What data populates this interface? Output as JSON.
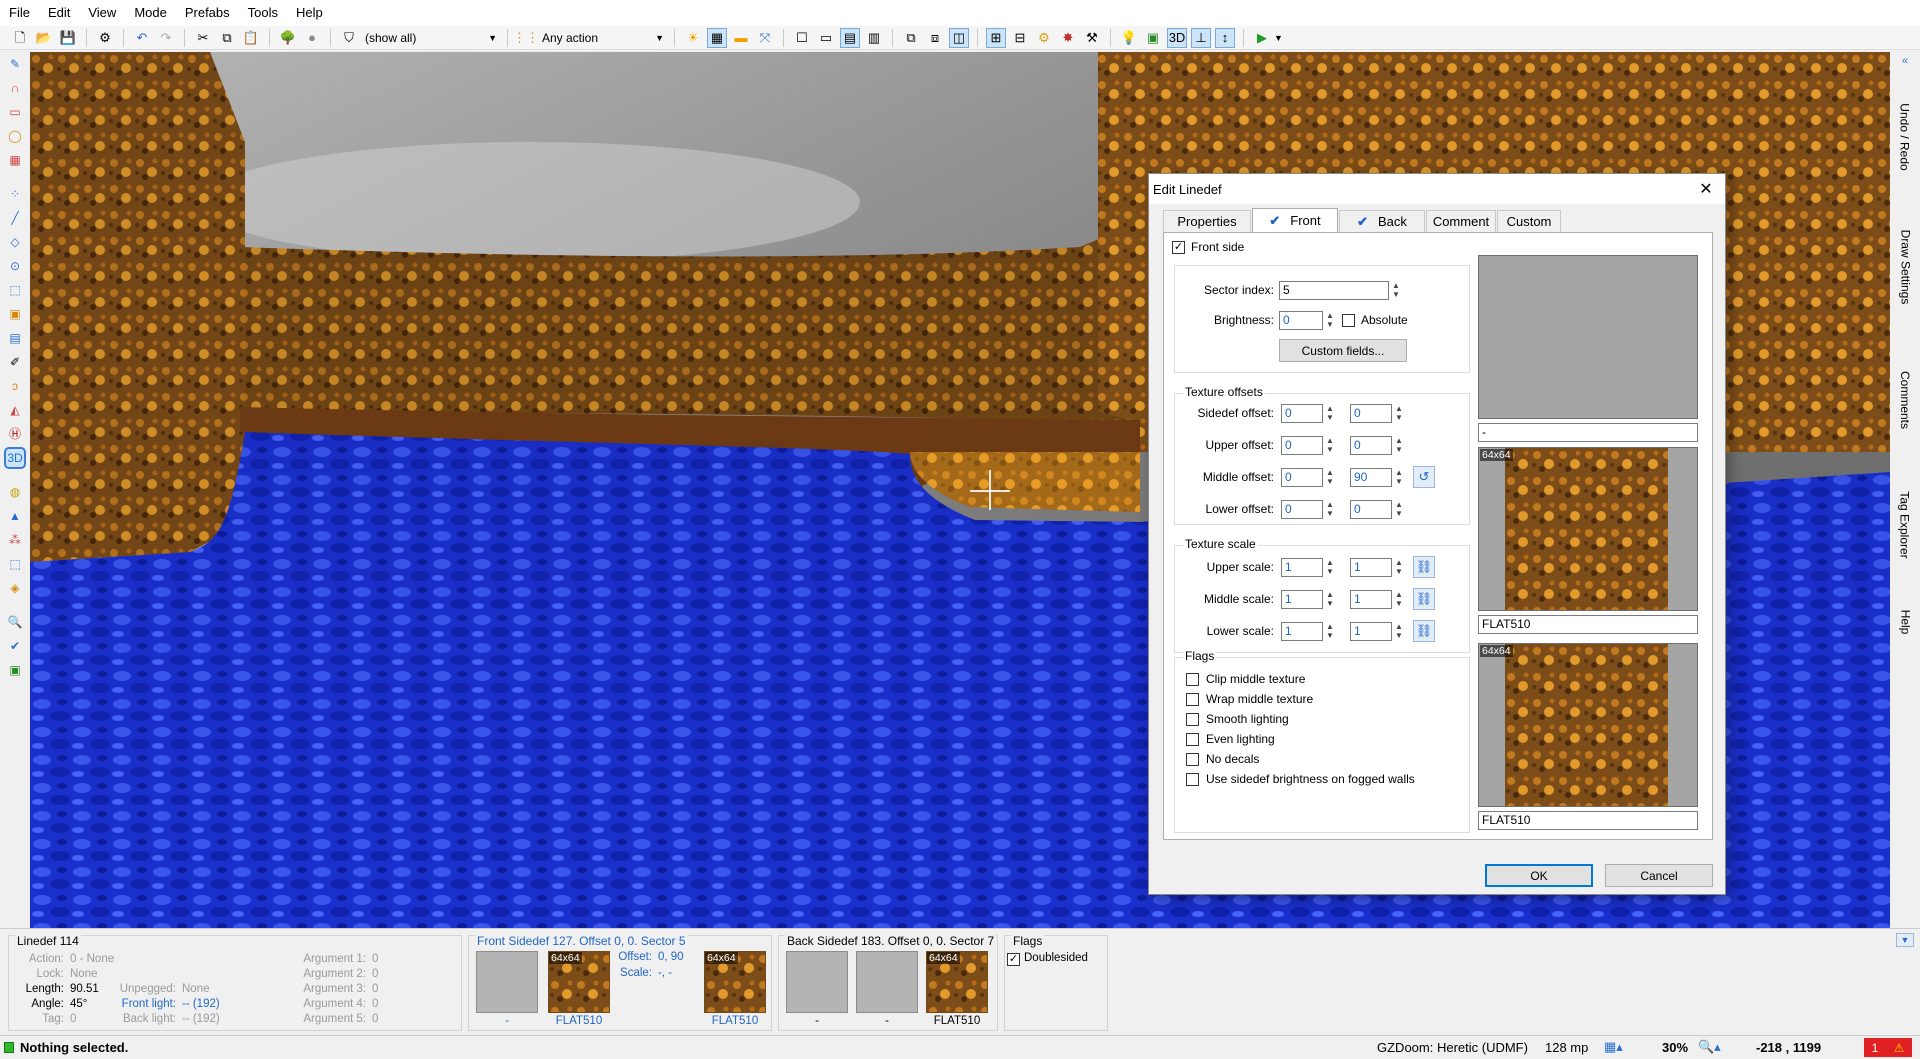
{
  "menu": [
    "File",
    "Edit",
    "View",
    "Mode",
    "Prefabs",
    "Tools",
    "Help"
  ],
  "toolbar": {
    "filter_label": "(show all)",
    "action_label": "Any action"
  },
  "dock_tabs": [
    "Undo / Redo",
    "Draw Settings",
    "Comments",
    "Tag Explorer",
    "Help"
  ],
  "dialog": {
    "title": "Edit Linedef",
    "tabs": [
      "Properties",
      "Front",
      "Back",
      "Comment",
      "Custom"
    ],
    "front_side_label": "Front side",
    "sector_index_label": "Sector index:",
    "sector_index_value": "5",
    "brightness_label": "Brightness:",
    "brightness_value": "0",
    "absolute_label": "Absolute",
    "custom_fields_button": "Custom fields...",
    "texture_offsets_title": "Texture offsets",
    "offsets": [
      {
        "label": "Sidedef offset:",
        "x": "0",
        "y": "0"
      },
      {
        "label": "Upper offset:",
        "x": "0",
        "y": "0"
      },
      {
        "label": "Middle offset:",
        "x": "0",
        "y": "90"
      },
      {
        "label": "Lower offset:",
        "x": "0",
        "y": "0"
      }
    ],
    "texture_scale_title": "Texture scale",
    "scales": [
      {
        "label": "Upper scale:",
        "x": "1",
        "y": "1"
      },
      {
        "label": "Middle scale:",
        "x": "1",
        "y": "1"
      },
      {
        "label": "Lower scale:",
        "x": "1",
        "y": "1"
      }
    ],
    "flags_title": "Flags",
    "flags": [
      "Clip middle texture",
      "Wrap middle texture",
      "Smooth lighting",
      "Even lighting",
      "No decals",
      "Use sidedef brightness on fogged walls"
    ],
    "upper_texture_name": "-",
    "middle_texture_name": "FLAT510",
    "lower_texture_name": "FLAT510",
    "texture_size": "64x64",
    "ok_label": "OK",
    "cancel_label": "Cancel"
  },
  "info": {
    "linedef_title": "Linedef 114",
    "action_label": "Action:",
    "action_value": "0 - None",
    "lock_label": "Lock:",
    "lock_value": "None",
    "length_label": "Length:",
    "length_value": "90.51",
    "unpegged_label": "Unpegged:",
    "unpegged_value": "None",
    "angle_label": "Angle:",
    "angle_value": "45°",
    "frontlight_label": "Front light:",
    "frontlight_value": "-- (192)",
    "tag_label": "Tag:",
    "tag_value": "0",
    "backlight_label": "Back light:",
    "backlight_value": "-- (192)",
    "args": [
      {
        "label": "Argument 1:",
        "value": "0"
      },
      {
        "label": "Argument 2:",
        "value": "0"
      },
      {
        "label": "Argument 3:",
        "value": "0"
      },
      {
        "label": "Argument 4:",
        "value": "0"
      },
      {
        "label": "Argument 5:",
        "value": "0"
      }
    ],
    "front_sidedef_title": "Front Sidedef 127. Offset 0, 0. Sector 5",
    "front_tex_labels": [
      "-",
      "FLAT510",
      "FLAT510"
    ],
    "offset_label": "Offset:",
    "offset_value": "0, 90",
    "scale_label": "Scale:",
    "scale_value": "-, -",
    "back_sidedef_title": "Back Sidedef 183. Offset 0, 0. Sector 7",
    "back_tex_labels": [
      "-",
      "-",
      "FLAT510"
    ],
    "flags_title": "Flags",
    "doublesided_label": "Doublesided"
  },
  "status": {
    "message": "Nothing selected.",
    "engine": "GZDoom: Heretic (UDMF)",
    "grid": "128 mp",
    "zoom": "30%",
    "coords": "-218 , 1199",
    "warnings": "1"
  },
  "colors": {
    "accent": "#0078d7",
    "water": "#1a2fc9",
    "wall": "#8a5a1e",
    "sky": "#8a8a8a",
    "link_blue": "#1f66c4"
  }
}
